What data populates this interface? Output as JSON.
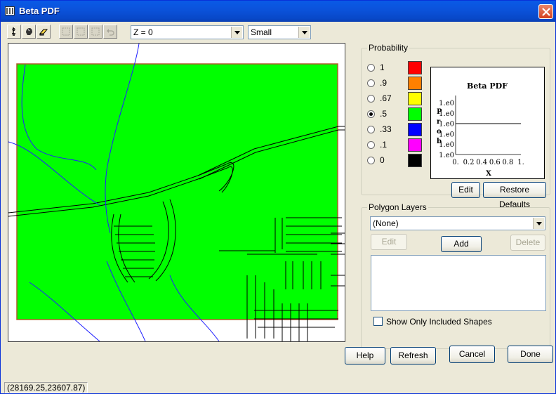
{
  "window": {
    "title": "Beta PDF"
  },
  "toolbar": {
    "z_combo": "Z = 0",
    "size_combo": "Small"
  },
  "probability": {
    "label": "Probability",
    "options": [
      {
        "label": "1",
        "color": "#ff0000",
        "selected": false
      },
      {
        "label": ".9",
        "color": "#ff8000",
        "selected": false
      },
      {
        "label": ".67",
        "color": "#ffff00",
        "selected": false
      },
      {
        "label": ".5",
        "color": "#00ff00",
        "selected": true
      },
      {
        "label": ".33",
        "color": "#0000ff",
        "selected": false
      },
      {
        "label": ".1",
        "color": "#ff00ff",
        "selected": false
      },
      {
        "label": "0",
        "color": "#000000",
        "selected": false
      }
    ],
    "edit_button": "Edit",
    "restore_button": "Restore Defaults"
  },
  "chart_data": {
    "type": "line",
    "title": "Beta PDF",
    "xlabel": "X",
    "ylabel": "Prob",
    "xticks": [
      "0.",
      "0.2",
      "0.4",
      "0.6",
      "0.8",
      "1."
    ],
    "yticks": [
      "1.e0",
      "1.e0",
      "1.e0",
      "1.e0",
      "1.e0",
      "1.e0"
    ],
    "xlim": [
      0,
      1
    ],
    "series": [
      {
        "x": [
          0,
          1
        ],
        "y": [
          1,
          1
        ]
      }
    ]
  },
  "polygon_layers": {
    "label": "Polygon Layers",
    "selected": "(None)",
    "edit_button": "Edit",
    "add_button": "Add",
    "delete_button": "Delete",
    "show_only_label": "Show Only Included Shapes"
  },
  "buttons": {
    "help": "Help",
    "refresh": "Refresh",
    "cancel": "Cancel",
    "done": "Done"
  },
  "status": {
    "coords": "(28169.25,23607.87)"
  },
  "map": {
    "fill_color": "#00ff00",
    "border_color": "#b05a2a",
    "road_color": "#000000",
    "stream_color": "#2020ff"
  }
}
